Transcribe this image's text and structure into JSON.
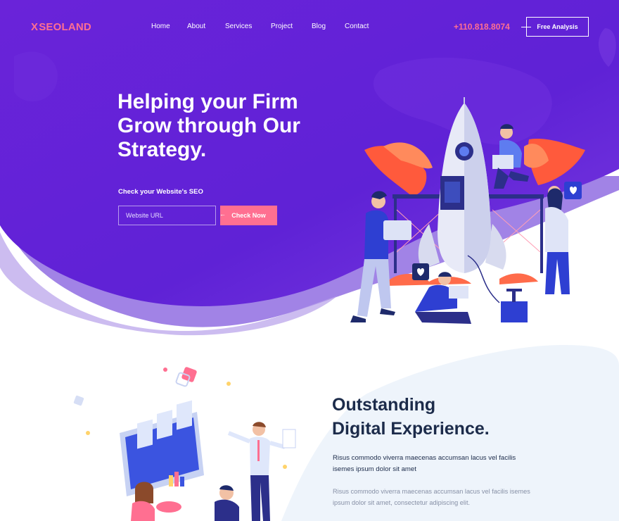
{
  "brand": {
    "logo_x": "X",
    "logo_text": "SEOLAND"
  },
  "nav": {
    "items": [
      {
        "label": "Home"
      },
      {
        "label": "About"
      },
      {
        "label": "Services"
      },
      {
        "label": "Project"
      },
      {
        "label": "Blog"
      },
      {
        "label": "Contact"
      }
    ]
  },
  "header": {
    "phone": "+110.818.8074",
    "cta_label": "Free Analysis"
  },
  "hero": {
    "title_line1": "Helping your Firm",
    "title_line2": "Grow through Our",
    "title_line3": "Strategy.",
    "seo_label": "Check your Website's SEO",
    "url_placeholder": "Website URL",
    "check_label": "Check Now"
  },
  "section2": {
    "title_line1": "Outstanding",
    "title_line2": "Digital Experience.",
    "para1": "Risus commodo viverra maecenas accumsan lacus vel facilis isemes ipsum dolor sit amet",
    "para2": "Risus commodo viverra maecenas accumsan lacus vel facilis isemes ipsum dolor sit amet, consectetur adipiscing elit."
  },
  "colors": {
    "primary": "#6a22d8",
    "accent": "#ff6f91",
    "dark": "#1c2b4a",
    "muted": "#8790a6"
  },
  "icons": [
    "rocket-illustration",
    "team-illustration",
    "arrow-icon"
  ]
}
